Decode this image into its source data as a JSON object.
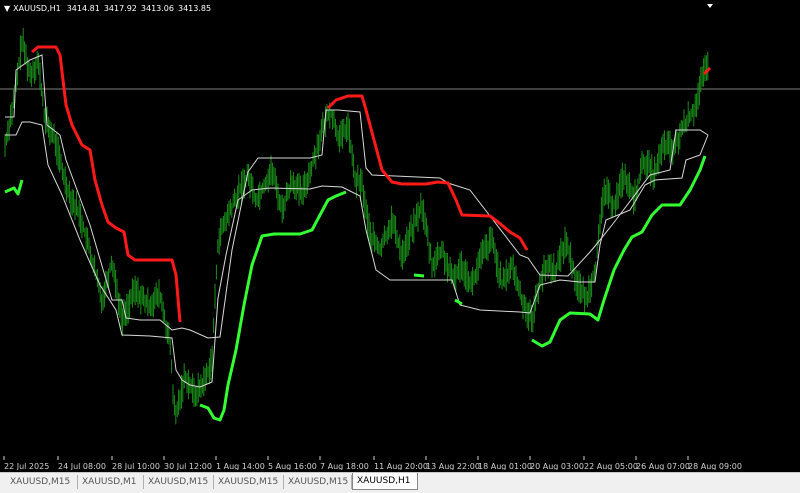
{
  "window": {
    "symbol": "XAUUSD,H1",
    "ohlc": [
      "3414.81",
      "3417.92",
      "3413.06",
      "3413.85"
    ]
  },
  "colors": {
    "background": "#000000",
    "candles": "#1a8f1a",
    "upper_band": "#ff1a1a",
    "lower_band": "#33ff33",
    "channel": "#d8d8d8",
    "axis_text": "#d0d0d0",
    "hline": "#808080"
  },
  "time_labels": [
    "22 Jul 2025",
    "24 Jul 08:00",
    "28 Jul 10:00",
    "30 Jul 12:00",
    "1 Aug 14:00",
    "5 Aug 16:00",
    "7 Aug 18:00",
    "11 Aug 20:00",
    "13 Aug 22:00",
    "18 Aug 01:00",
    "20 Aug 03:00",
    "22 Aug 05:00",
    "26 Aug 07:00",
    "28 Aug 09:00"
  ],
  "tabs": [
    {
      "label": "XAUUSD,M15",
      "active": false
    },
    {
      "label": "XAUUSD,M1",
      "active": false
    },
    {
      "label": "XAUUSD,M15",
      "active": false
    },
    {
      "label": "XAUUSD,M15",
      "active": false
    },
    {
      "label": "XAUUSD,M15",
      "active": false
    },
    {
      "label": "XAUUSD,H1",
      "active": true
    }
  ],
  "icons": {
    "window_menu": "triangle-down-icon",
    "tab_menu": "triangle-down-icon"
  }
}
